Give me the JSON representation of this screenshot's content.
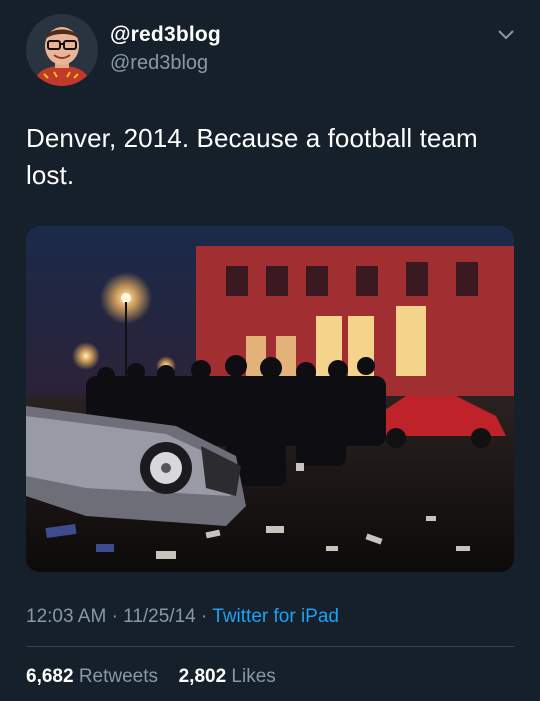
{
  "author": {
    "display_name": "@red3blog",
    "handle": "@red3blog"
  },
  "tweet": {
    "text": "Denver, 2014. Because a football team lost."
  },
  "meta": {
    "time": "12:03 AM",
    "separator": "·",
    "date": "11/25/14",
    "source": "Twitter for iPad"
  },
  "stats": {
    "retweets_count": "6,682",
    "retweets_label": "Retweets",
    "likes_count": "2,802",
    "likes_label": "Likes"
  },
  "colors": {
    "background": "#15202b",
    "secondary_text": "#8899a6",
    "link": "#1da1f2",
    "divider": "#38444d"
  },
  "icons": {
    "menu": "chevron-down-icon",
    "avatar": "avatar"
  }
}
